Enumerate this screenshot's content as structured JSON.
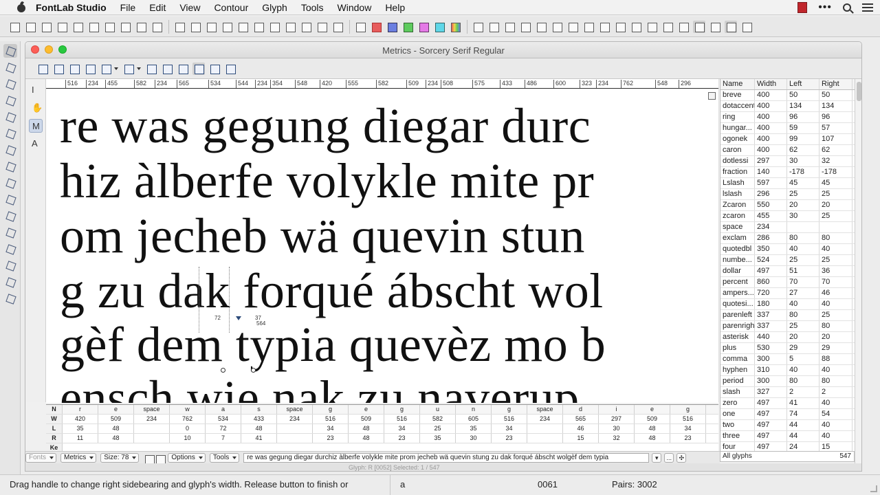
{
  "menubar": {
    "app": "FontLab Studio",
    "items": [
      "File",
      "Edit",
      "View",
      "Contour",
      "Glyph",
      "Tools",
      "Window",
      "Help"
    ]
  },
  "window": {
    "title": "Metrics - Sorcery Serif Regular"
  },
  "ruler": {
    "cells": [
      "516",
      "234",
      "455",
      "582",
      "234",
      "565",
      "534",
      "544",
      "234",
      "354",
      "548",
      "420",
      "555",
      "582",
      "509",
      "234",
      "508",
      "575",
      "433",
      "486",
      "600",
      "323",
      "234",
      "762",
      "548",
      "296"
    ]
  },
  "canvas": {
    "lines": [
      "re was gegung diegar durc",
      "hiz àlberfe volykle mite pr",
      "om jecheb wä quevin stun",
      "g zu dak forqué ábscht wol",
      "gèf dem typia quevèz mo b",
      "ensch wie nak zu naverup"
    ],
    "metric_left": "72",
    "metric_right": "37",
    "metric_width": "564"
  },
  "glyph_table": {
    "headers": [
      "Name",
      "Width",
      "Left",
      "Right"
    ],
    "rows": [
      [
        "breve",
        "400",
        "50",
        "50"
      ],
      [
        "dotaccent",
        "400",
        "134",
        "134"
      ],
      [
        "ring",
        "400",
        "96",
        "96"
      ],
      [
        "hungar...",
        "400",
        "59",
        "57"
      ],
      [
        "ogonek",
        "400",
        "99",
        "107"
      ],
      [
        "caron",
        "400",
        "62",
        "62"
      ],
      [
        "dotlessi",
        "297",
        "30",
        "32"
      ],
      [
        "fraction",
        "140",
        "-178",
        "-178"
      ],
      [
        "Lslash",
        "597",
        "45",
        "45"
      ],
      [
        "lslash",
        "296",
        "25",
        "25"
      ],
      [
        "Zcaron",
        "550",
        "20",
        "20"
      ],
      [
        "zcaron",
        "455",
        "30",
        "25"
      ],
      [
        "space",
        "234",
        "",
        ""
      ],
      [
        "exclam",
        "286",
        "80",
        "80"
      ],
      [
        "quotedbl",
        "350",
        "40",
        "40"
      ],
      [
        "numbe...",
        "524",
        "25",
        "25"
      ],
      [
        "dollar",
        "497",
        "51",
        "36"
      ],
      [
        "percent",
        "860",
        "70",
        "70"
      ],
      [
        "ampers...",
        "720",
        "27",
        "46"
      ],
      [
        "quotesi...",
        "180",
        "40",
        "40"
      ],
      [
        "parenleft",
        "337",
        "80",
        "25"
      ],
      [
        "parenright",
        "337",
        "25",
        "80"
      ],
      [
        "asterisk",
        "440",
        "20",
        "20"
      ],
      [
        "plus",
        "530",
        "29",
        "29"
      ],
      [
        "comma",
        "300",
        "5",
        "88"
      ],
      [
        "hyphen",
        "310",
        "40",
        "40"
      ],
      [
        "period",
        "300",
        "80",
        "80"
      ],
      [
        "slash",
        "327",
        "2",
        "2"
      ],
      [
        "zero",
        "497",
        "41",
        "40"
      ],
      [
        "one",
        "497",
        "74",
        "54"
      ],
      [
        "two",
        "497",
        "44",
        "40"
      ],
      [
        "three",
        "497",
        "44",
        "40"
      ],
      [
        "four",
        "497",
        "24",
        "15"
      ]
    ],
    "filter": "All glyphs",
    "count": "547"
  },
  "metrics_table": {
    "row_labels": [
      "N",
      "W",
      "L",
      "R"
    ],
    "names": [
      "r",
      "e",
      "space",
      "w",
      "a",
      "s",
      "space",
      "g",
      "e",
      "g",
      "u",
      "n",
      "g",
      "space",
      "d",
      "i",
      "e",
      "g"
    ],
    "widths": [
      "420",
      "509",
      "234",
      "762",
      "534",
      "433",
      "234",
      "516",
      "509",
      "516",
      "582",
      "605",
      "516",
      "234",
      "565",
      "297",
      "509",
      "516"
    ],
    "lefts": [
      "35",
      "48",
      "",
      "0",
      "72",
      "48",
      "",
      "34",
      "48",
      "34",
      "25",
      "35",
      "34",
      "",
      "46",
      "30",
      "48",
      "34"
    ],
    "rights": [
      "11",
      "48",
      "",
      "10",
      "7",
      "41",
      "",
      "23",
      "48",
      "23",
      "35",
      "30",
      "23",
      "",
      "15",
      "32",
      "48",
      "23"
    ],
    "kern_label": "Ke"
  },
  "controls": {
    "fonts": "Fonts",
    "mode": "Metrics",
    "size": "Size: 78",
    "options": "Options",
    "tools": "Tools",
    "text": "re was gegung diegar durchiz àlberfe volykle mite prom jecheb wä quevin stung zu dak forqué ábscht wolgèf dem typia",
    "more": "..."
  },
  "mini_status": {
    "text": "Glyph: R [0052]   Selected: 1 / 547"
  },
  "statusbar": {
    "message": "Drag handle to change right sidebearing and glyph's width. Release button to finish or",
    "char": "a",
    "code": "0061",
    "pairs": "Pairs: 3002"
  }
}
